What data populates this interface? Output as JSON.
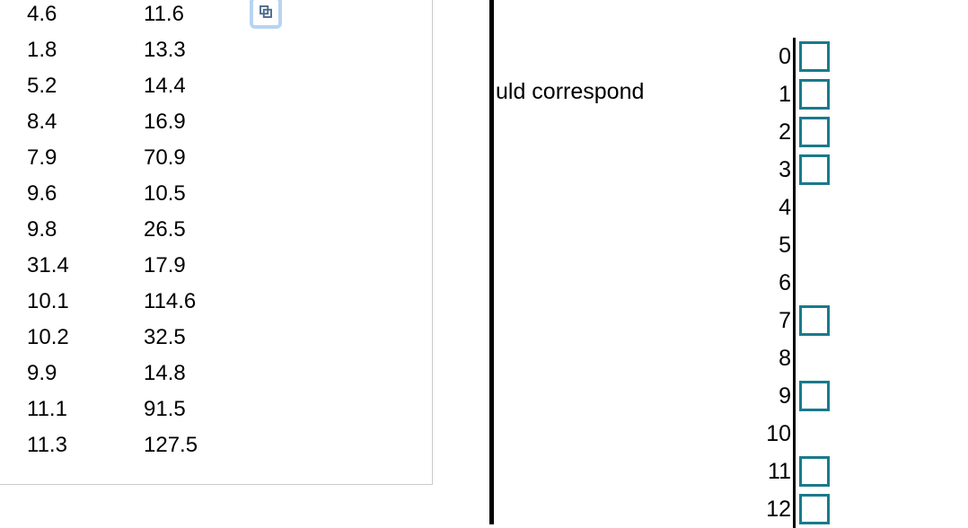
{
  "table": {
    "rows": [
      {
        "c1": "4.6",
        "c2": "11.6"
      },
      {
        "c1": "1.8",
        "c2": "13.3"
      },
      {
        "c1": "5.2",
        "c2": "14.4"
      },
      {
        "c1": "8.4",
        "c2": "16.9"
      },
      {
        "c1": "7.9",
        "c2": "70.9"
      },
      {
        "c1": "9.6",
        "c2": "10.5"
      },
      {
        "c1": "9.8",
        "c2": "26.5"
      },
      {
        "c1": "31.4",
        "c2": "17.9"
      },
      {
        "c1": "10.1",
        "c2": "114.6"
      },
      {
        "c1": "10.2",
        "c2": "32.5"
      },
      {
        "c1": "9.9",
        "c2": "14.8"
      },
      {
        "c1": "11.1",
        "c2": "91.5"
      },
      {
        "c1": "11.3",
        "c2": "127.5"
      }
    ]
  },
  "right_fragment": "uld correspond",
  "answers": [
    {
      "label": "0",
      "box": true
    },
    {
      "label": "1",
      "box": true
    },
    {
      "label": "2",
      "box": true
    },
    {
      "label": "3",
      "box": true
    },
    {
      "label": "4",
      "box": false
    },
    {
      "label": "5",
      "box": false
    },
    {
      "label": "6",
      "box": false
    },
    {
      "label": "7",
      "box": true
    },
    {
      "label": "8",
      "box": false
    },
    {
      "label": "9",
      "box": true
    },
    {
      "label": "10",
      "box": false
    },
    {
      "label": "11",
      "box": true
    },
    {
      "label": "12",
      "box": true
    }
  ]
}
